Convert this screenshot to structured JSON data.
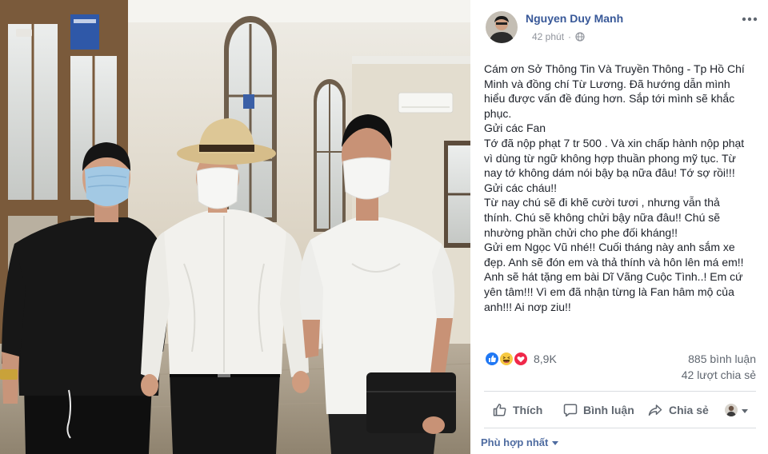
{
  "post": {
    "author": "Nguyen Duy Manh",
    "time": "42 phút",
    "separator": "·",
    "privacy_icon": "globe-icon",
    "lines": [
      "Cám ơn Sở Thông Tin Và Truyền Thông - Tp Hồ Chí",
      "Minh và đồng chí Từ Lương. Đã hướng dẫn mình",
      "hiểu được vấn đề đúng hơn. Sắp tới mình sẽ khắc",
      "phục.",
      "Gửi các Fan",
      "Tớ đã nộp phạt 7 tr 500 . Và xin chấp hành nộp phạt",
      "vì dùng từ ngữ không hợp thuần phong mỹ tục. Từ",
      "nay tớ không dám nói bậy bạ nữa đâu! Tớ sợ rồi!!!",
      "Gửi các cháu!!",
      "Từ nay chú sẽ đi khẽ cười tươi , nhưng vẫn thả",
      "thính. Chú sẽ không chửi bậy nữa đâu!! Chú sẽ",
      "nhường phần chửi cho phe đối kháng!!",
      "Gửi em Ngọc Vũ nhé!! Cuối tháng này anh sắm xe",
      "đẹp. Anh sẽ đón em và thả thính và hôn lên má em!!",
      "Anh sẽ hát tặng em bài Dĩ Vãng Cuộc Tình..! Em cứ",
      "yên tâm!!! Vì em đã nhận từng là Fan hâm mộ của",
      "anh!!! Ai nơp ziu!!"
    ]
  },
  "reactions": {
    "icons": [
      "like-reaction-icon",
      "haha-reaction-icon",
      "love-reaction-icon"
    ],
    "count": "8,9K"
  },
  "stats": {
    "comments": "885 bình luận",
    "shares": "42 lượt chia sẻ"
  },
  "actions": {
    "like": {
      "label": "Thích",
      "icon": "thumbs-up-icon"
    },
    "comment": {
      "label": "Bình luận",
      "icon": "comment-icon"
    },
    "share": {
      "label": "Chia sẻ",
      "icon": "share-icon"
    }
  },
  "comments": {
    "sort_label": "Phù hợp nhất"
  },
  "colors": {
    "link": "#385898",
    "text": "#1d2129",
    "muted": "#606770",
    "like": "#2078f4",
    "haha": "#f7c942",
    "love": "#f0284a",
    "sort": "#4e6ba0"
  }
}
